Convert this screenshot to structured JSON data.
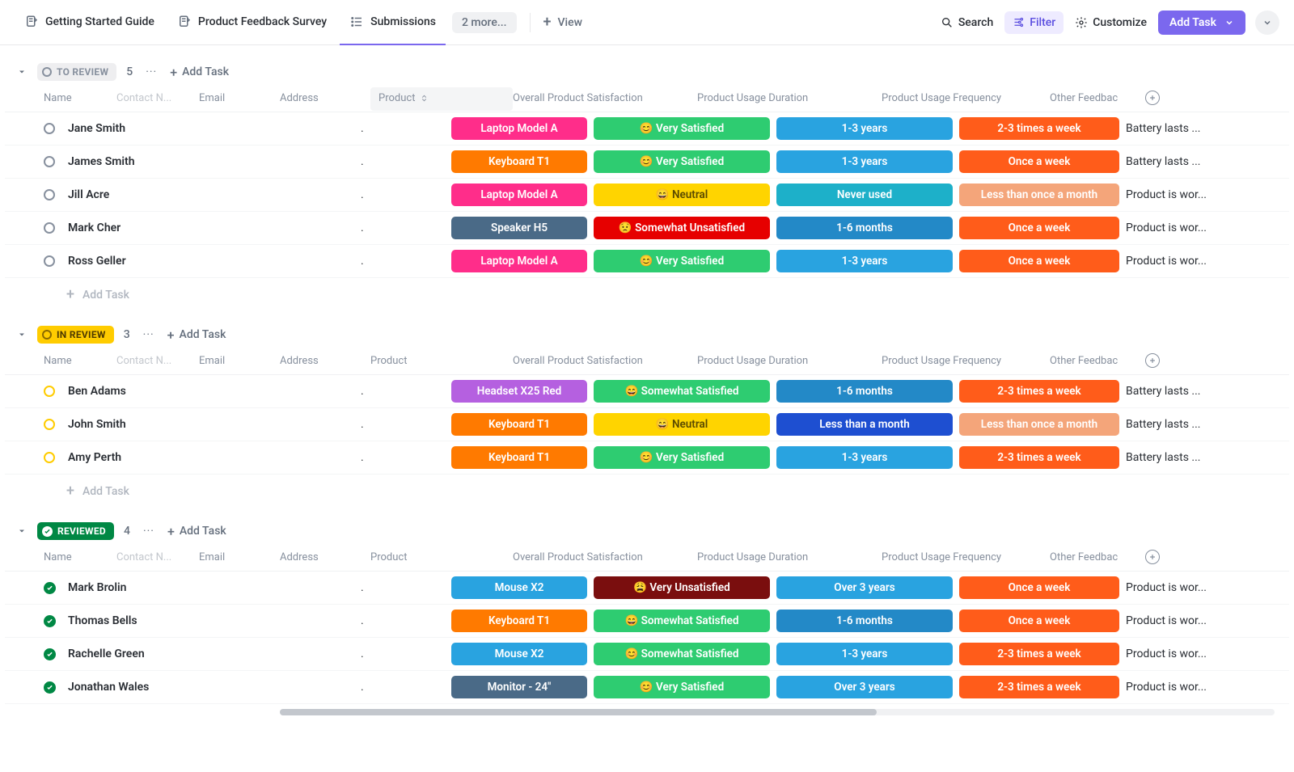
{
  "topbar": {
    "tabs": [
      {
        "label": "Getting Started Guide"
      },
      {
        "label": "Product Feedback Survey"
      },
      {
        "label": "Submissions"
      }
    ],
    "more_label": "2 more...",
    "view_label": "View",
    "search_label": "Search",
    "filter_label": "Filter",
    "customize_label": "Customize",
    "add_task_label": "Add Task"
  },
  "columns": {
    "name": "Name",
    "contact": "Contact N...",
    "email": "Email",
    "address": "Address",
    "product": "Product",
    "satisfaction": "Overall Product Satisfaction",
    "duration": "Product Usage Duration",
    "frequency": "Product Usage Frequency",
    "other": "Other Feedbac"
  },
  "ui": {
    "dots": "···",
    "add_task": "Add Task",
    "plus": "+"
  },
  "colors": {
    "pink": "#ff2d8a",
    "orange": "#ff7a00",
    "bluegrey": "#4a6a87",
    "purple": "#b560e0",
    "skyblue": "#29a3e0",
    "teal": "#1db0c9",
    "navy": "#1e4fd1",
    "blue2": "#2389c7",
    "green": "#2ecc71",
    "yellow": "#ffd400",
    "yellow_text": "#5a4a00",
    "red": "#e60000",
    "maroon": "#7a0e0e",
    "peach": "#f4a57a",
    "orange2": "#ff5c1a"
  },
  "groups": [
    {
      "key": "to_review",
      "label": "TO REVIEW",
      "count": "5",
      "pill_class": "review",
      "status_icon": "circle-grey",
      "product_sorted": true,
      "rows": [
        {
          "name": "Jane Smith",
          "addr": ".",
          "product": {
            "t": "Laptop Model A",
            "c": "pink"
          },
          "sat": {
            "t": "😊 Very Satisfied",
            "c": "green"
          },
          "dur": {
            "t": "1-3 years",
            "c": "skyblue"
          },
          "freq": {
            "t": "2-3 times a week",
            "c": "orange2"
          },
          "other": "Battery lasts ..."
        },
        {
          "name": "James Smith",
          "addr": ".",
          "product": {
            "t": "Keyboard T1",
            "c": "orange"
          },
          "sat": {
            "t": "😊 Very Satisfied",
            "c": "green"
          },
          "dur": {
            "t": "1-3 years",
            "c": "skyblue"
          },
          "freq": {
            "t": "Once a week",
            "c": "orange2"
          },
          "other": "Battery lasts ..."
        },
        {
          "name": "Jill Acre",
          "addr": ".",
          "product": {
            "t": "Laptop Model A",
            "c": "pink"
          },
          "sat": {
            "t": "😄 Neutral",
            "c": "yellow",
            "tc": "yellow_text"
          },
          "dur": {
            "t": "Never used",
            "c": "teal"
          },
          "freq": {
            "t": "Less than once a month",
            "c": "peach"
          },
          "other": "Product is wor..."
        },
        {
          "name": "Mark Cher",
          "addr": ".",
          "product": {
            "t": "Speaker H5",
            "c": "bluegrey"
          },
          "sat": {
            "t": "😟 Somewhat Unsatisfied",
            "c": "red"
          },
          "dur": {
            "t": "1-6 months",
            "c": "blue2"
          },
          "freq": {
            "t": "Once a week",
            "c": "orange2"
          },
          "other": "Product is wor..."
        },
        {
          "name": "Ross Geller",
          "addr": ".",
          "product": {
            "t": "Laptop Model A",
            "c": "pink"
          },
          "sat": {
            "t": "😊 Very Satisfied",
            "c": "green"
          },
          "dur": {
            "t": "1-3 years",
            "c": "skyblue"
          },
          "freq": {
            "t": "Once a week",
            "c": "orange2"
          },
          "other": "Product is wor..."
        }
      ]
    },
    {
      "key": "in_review",
      "label": "IN REVIEW",
      "count": "3",
      "pill_class": "inreview",
      "status_icon": "circle-yellow",
      "product_sorted": false,
      "rows": [
        {
          "name": "Ben Adams",
          "addr": ".",
          "product": {
            "t": "Headset X25 Red",
            "c": "purple"
          },
          "sat": {
            "t": "😄 Somewhat Satisfied",
            "c": "green"
          },
          "dur": {
            "t": "1-6 months",
            "c": "blue2"
          },
          "freq": {
            "t": "2-3 times a week",
            "c": "orange2"
          },
          "other": "Battery lasts ..."
        },
        {
          "name": "John Smith",
          "addr": ".",
          "product": {
            "t": "Keyboard T1",
            "c": "orange"
          },
          "sat": {
            "t": "😄 Neutral",
            "c": "yellow",
            "tc": "yellow_text"
          },
          "dur": {
            "t": "Less than a month",
            "c": "navy"
          },
          "freq": {
            "t": "Less than once a month",
            "c": "peach"
          },
          "other": "Battery lasts ..."
        },
        {
          "name": "Amy Perth",
          "addr": ".",
          "product": {
            "t": "Keyboard T1",
            "c": "orange"
          },
          "sat": {
            "t": "😊 Very Satisfied",
            "c": "green"
          },
          "dur": {
            "t": "1-3 years",
            "c": "skyblue"
          },
          "freq": {
            "t": "2-3 times a week",
            "c": "orange2"
          },
          "other": "Battery lasts ..."
        }
      ]
    },
    {
      "key": "reviewed",
      "label": "REVIEWED",
      "count": "4",
      "pill_class": "reviewed",
      "status_icon": "check-green",
      "product_sorted": false,
      "rows": [
        {
          "name": "Mark Brolin",
          "addr": ".",
          "product": {
            "t": "Mouse X2",
            "c": "skyblue"
          },
          "sat": {
            "t": "😩 Very Unsatisfied",
            "c": "maroon"
          },
          "dur": {
            "t": "Over 3 years",
            "c": "skyblue"
          },
          "freq": {
            "t": "Once a week",
            "c": "orange2"
          },
          "other": "Product is wor..."
        },
        {
          "name": "Thomas Bells",
          "addr": ".",
          "product": {
            "t": "Keyboard T1",
            "c": "orange"
          },
          "sat": {
            "t": "😄 Somewhat Satisfied",
            "c": "green"
          },
          "dur": {
            "t": "1-6 months",
            "c": "blue2"
          },
          "freq": {
            "t": "Once a week",
            "c": "orange2"
          },
          "other": "Product is wor..."
        },
        {
          "name": "Rachelle Green",
          "addr": ".",
          "product": {
            "t": "Mouse X2",
            "c": "skyblue"
          },
          "sat": {
            "t": "😊 Somewhat Satisfied",
            "c": "green"
          },
          "dur": {
            "t": "1-3 years",
            "c": "skyblue"
          },
          "freq": {
            "t": "2-3 times a week",
            "c": "orange2"
          },
          "other": "Product is wor..."
        },
        {
          "name": "Jonathan Wales",
          "addr": ".",
          "product": {
            "t": "Monitor - 24\"",
            "c": "bluegrey"
          },
          "sat": {
            "t": "😊 Very Satisfied",
            "c": "green"
          },
          "dur": {
            "t": "Over 3 years",
            "c": "skyblue"
          },
          "freq": {
            "t": "2-3 times a week",
            "c": "orange2"
          },
          "other": "Product is wor..."
        }
      ]
    }
  ]
}
